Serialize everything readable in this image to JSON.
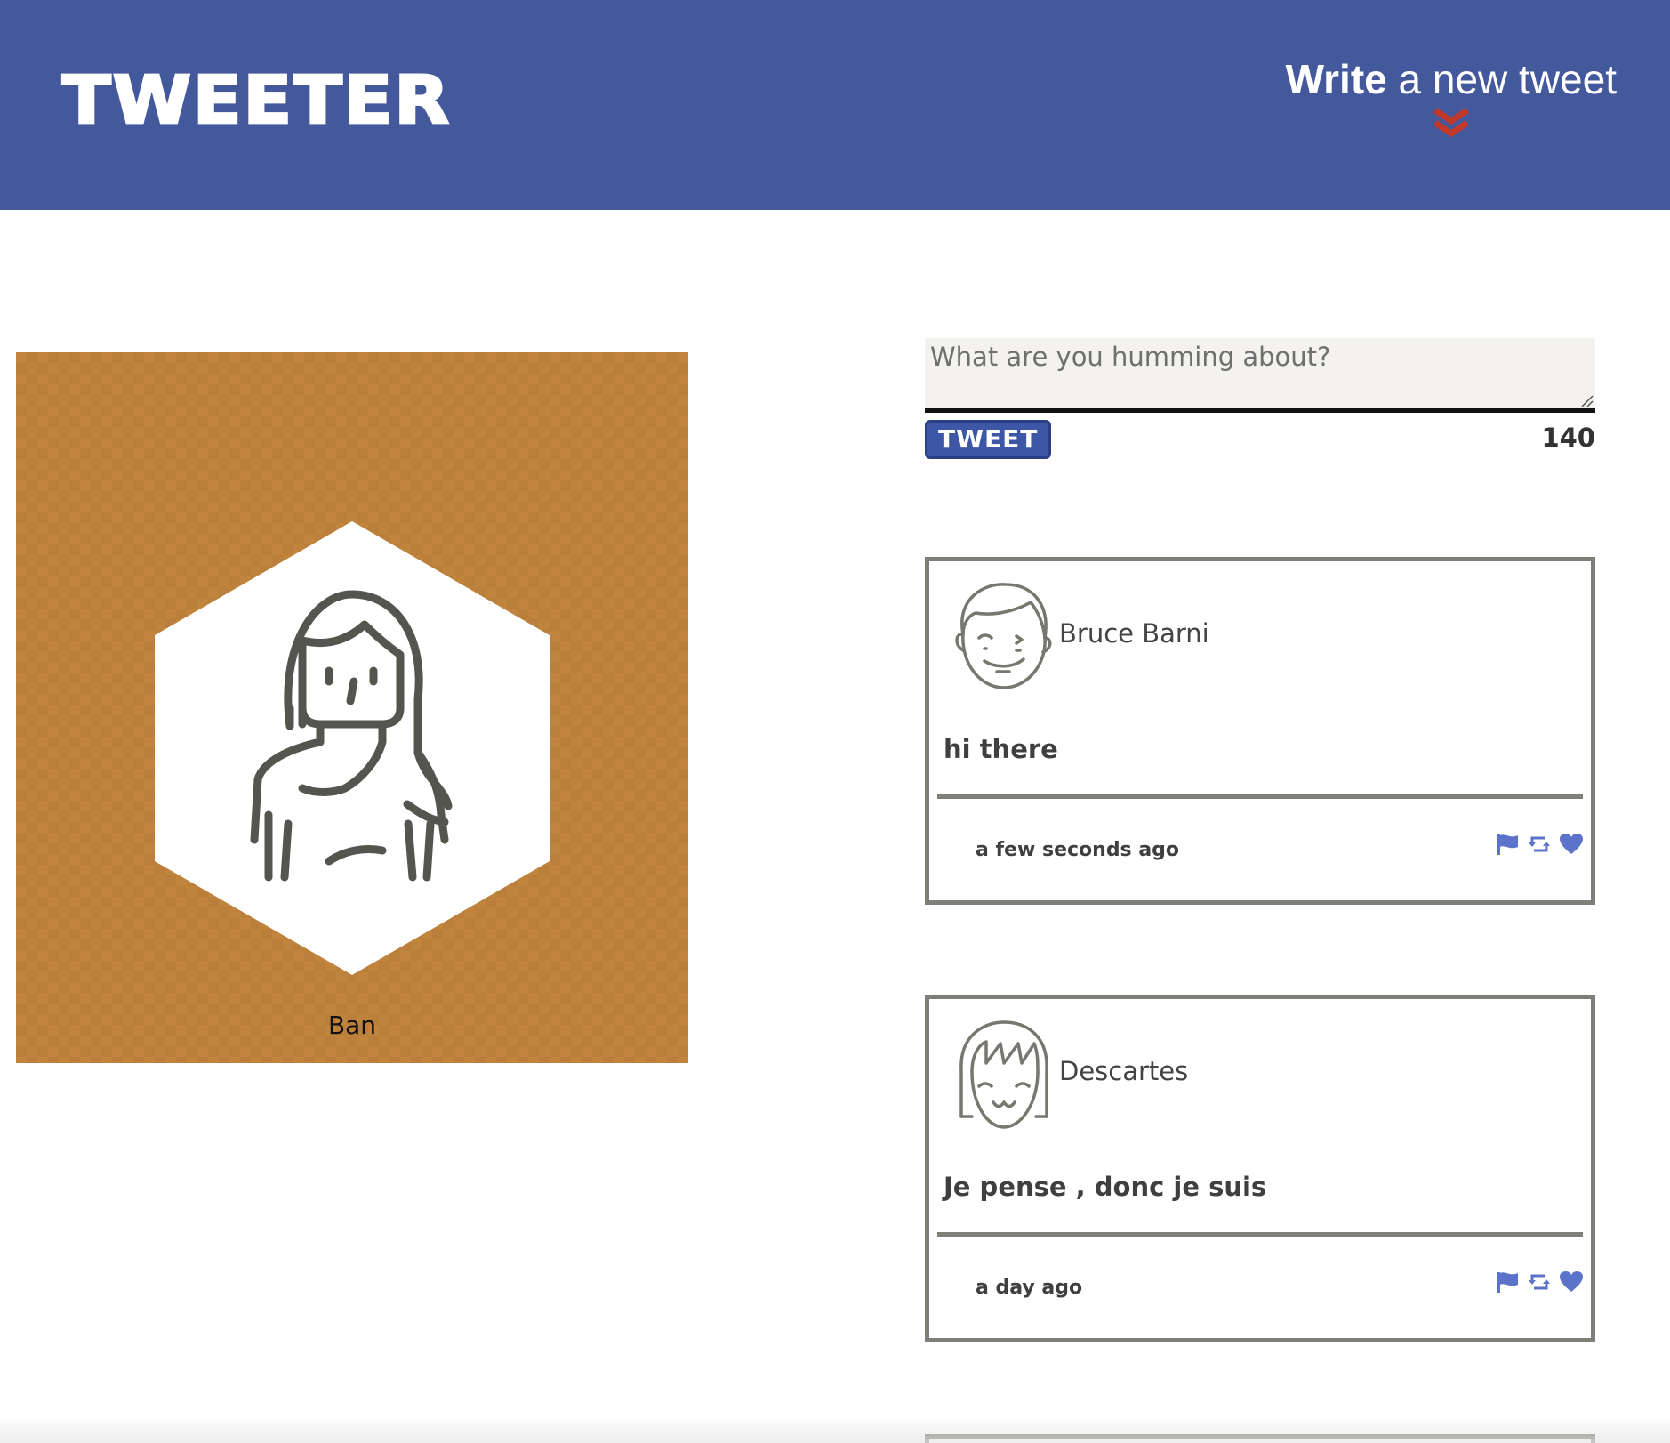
{
  "header": {
    "brand": "TWEETER",
    "compose_toggle": {
      "word1": "Write",
      "rest": " a new tweet",
      "icon": "double-chevron-down-icon"
    },
    "colors": {
      "bar": "#44589c",
      "chevron": "#c0392b"
    }
  },
  "profile": {
    "name": "Ban",
    "avatar_icon": "woman-avatar-icon",
    "background_color": "#c1843c"
  },
  "composer": {
    "placeholder": "What are you humming about?",
    "value": "",
    "submit_label": "TWEET",
    "char_counter": "140"
  },
  "tweets": [
    {
      "author": "Bruce Barni",
      "avatar_icon": "man-avatar-icon",
      "content": "hi there",
      "timestamp": "a few seconds ago",
      "actions": [
        "flag-icon",
        "retweet-icon",
        "heart-icon"
      ]
    },
    {
      "author": "Descartes",
      "avatar_icon": "girl-avatar-icon",
      "content": "Je pense , donc je suis",
      "timestamp": "a day ago",
      "actions": [
        "flag-icon",
        "retweet-icon",
        "heart-icon"
      ]
    }
  ],
  "icon_color": "#5b73c9"
}
